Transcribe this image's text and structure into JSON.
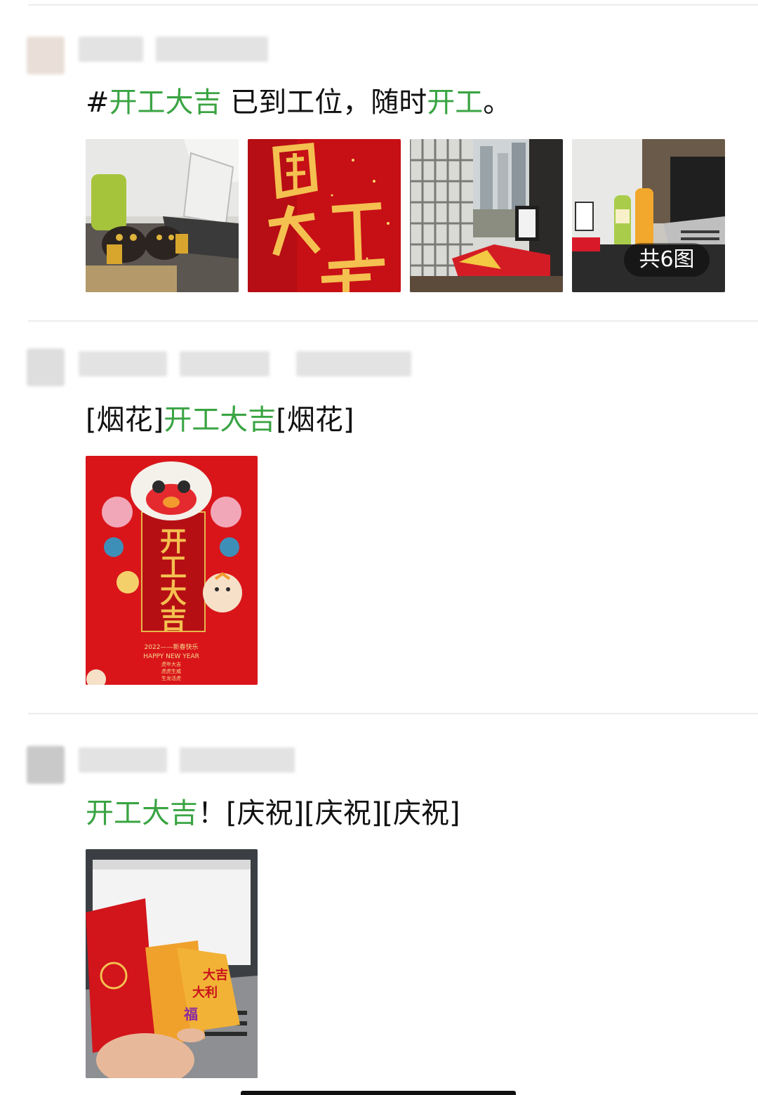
{
  "posts": [
    {
      "text": {
        "p1": "#",
        "p2": "开工大吉",
        "p3": " 已到工位，随时",
        "p4": "开工",
        "p5": "。"
      },
      "images": [
        {
          "name": "desk-lion-photo"
        },
        {
          "name": "kaigong-red-card"
        },
        {
          "name": "office-window-photo"
        },
        {
          "name": "laptop-drinks-photo"
        }
      ],
      "image_count_label": "共6图"
    },
    {
      "text": {
        "p1": "[烟花]",
        "p2": "开工大吉",
        "p3": "[烟花]"
      },
      "image": {
        "title": "开工大吉",
        "year_line": "2022——新春快乐",
        "english": "HAPPY NEW YEAR",
        "line1": "虎年大吉",
        "line2": "虎虎生威",
        "line3": "生龙活虎"
      }
    },
    {
      "text": {
        "p1": "开工大吉",
        "p2": "！[庆祝][庆祝][庆祝]"
      },
      "image": {
        "envelope_text1": "大吉",
        "envelope_text2": "大利",
        "envelope_text3": "福"
      }
    }
  ],
  "colors": {
    "link_green": "#3aa443",
    "divider": "#ececec",
    "red": "#d61518",
    "gold": "#f4c050"
  }
}
